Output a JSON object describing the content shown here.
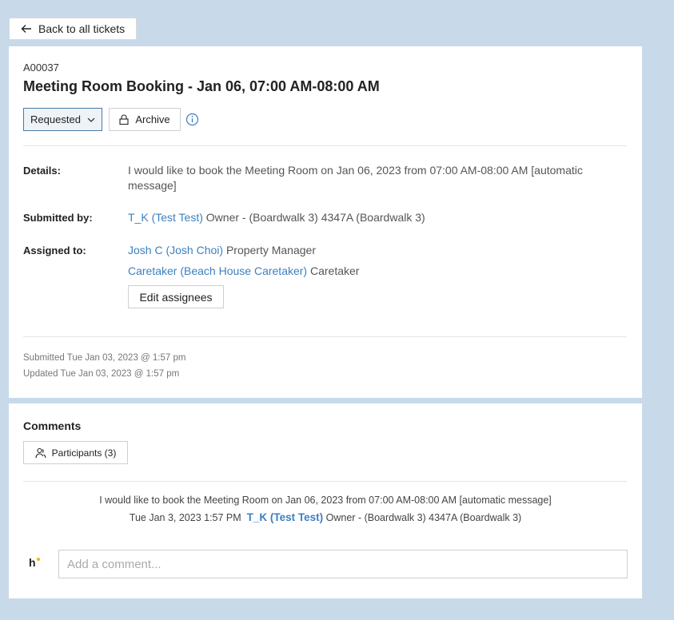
{
  "nav": {
    "back_label": "Back to all tickets"
  },
  "ticket": {
    "id": "A00037",
    "title": "Meeting Room Booking - Jan 06, 07:00 AM-08:00 AM",
    "status": "Requested",
    "archive_label": "Archive",
    "details_label": "Details:",
    "details_text": "I would like to book the Meeting Room on Jan 06, 2023 from 07:00 AM-08:00 AM [automatic message]",
    "submitted_by_label": "Submitted by:",
    "submitted_by": {
      "name": "T_K (Test Test)",
      "role": "Owner - (Boardwalk 3) 4347A (Boardwalk 3)"
    },
    "assigned_to_label": "Assigned to:",
    "assignees": [
      {
        "name": "Josh C (Josh Choi)",
        "role": "Property Manager"
      },
      {
        "name": "Caretaker (Beach House Caretaker)",
        "role": "Caretaker"
      }
    ],
    "edit_assignees_label": "Edit assignees",
    "submitted_at": "Submitted Tue Jan 03, 2023 @ 1:57 pm",
    "updated_at": "Updated Tue Jan 03, 2023 @ 1:57 pm"
  },
  "comments": {
    "title": "Comments",
    "participants_label": "Participants (3)",
    "items": [
      {
        "text": "I would like to book the Meeting Room on Jan 06, 2023 from 07:00 AM-08:00 AM [automatic message]",
        "time": "Tue Jan 3, 2023 1:57 PM",
        "author": "T_K (Test Test)",
        "author_role": "Owner - (Boardwalk 3) 4347A (Boardwalk 3)"
      }
    ],
    "avatar_letter": "h",
    "input_placeholder": "Add a comment..."
  },
  "colors": {
    "accent": "#3d7fc1",
    "background": "#c8d9ea",
    "avatar_dot": "#f2b705"
  },
  "icons": [
    "arrow-left-icon",
    "chevron-down-icon",
    "lock-icon",
    "info-icon",
    "participants-icon"
  ]
}
